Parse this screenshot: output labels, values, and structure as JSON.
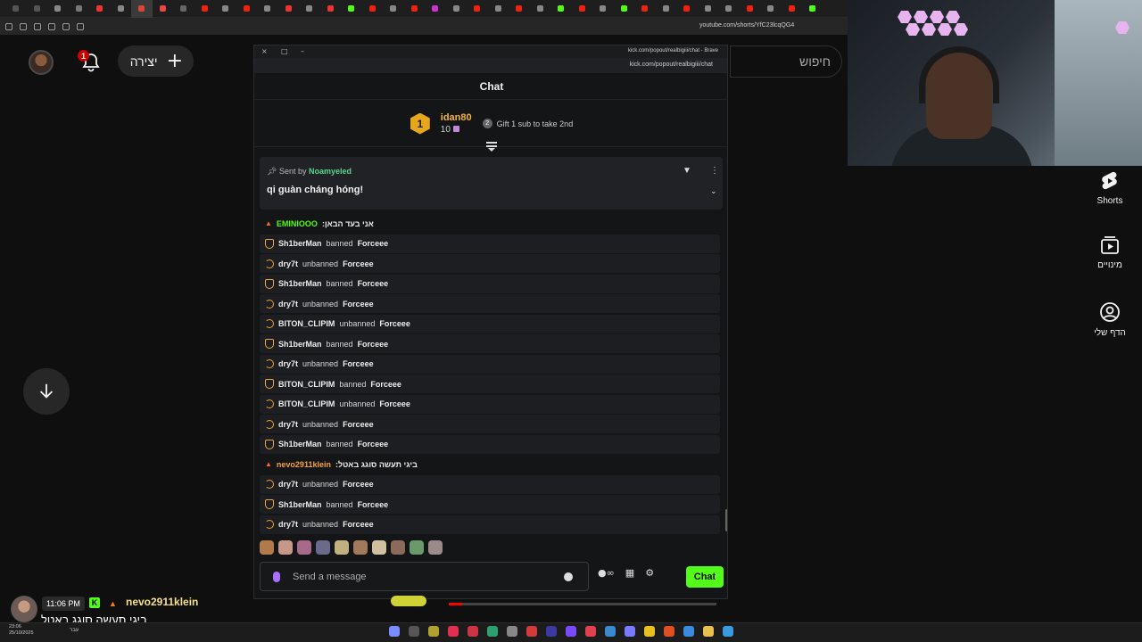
{
  "browser": {
    "url": "youtube.com/shorts/YfC23lcqQG4",
    "tab_colors": [
      "#555",
      "#555",
      "#888",
      "#777",
      "#e33",
      "#888",
      "#d43",
      "#e44",
      "#666",
      "#e21",
      "#888",
      "#e21",
      "#888",
      "#e33",
      "#888",
      "#e33",
      "#53fc18",
      "#e21",
      "#888",
      "#e21",
      "#c3c",
      "#888",
      "#e21",
      "#888",
      "#e21",
      "#888",
      "#53fc18",
      "#e21",
      "#888",
      "#53fc18",
      "#e21",
      "#888",
      "#e21",
      "#888",
      "#888",
      "#e21",
      "#888",
      "#e21",
      "#53fc18"
    ]
  },
  "youtube": {
    "notifications_count": "1",
    "create_label": "יצירה",
    "search_placeholder": "חיפוש",
    "rail": [
      {
        "label": "Shorts",
        "icon": "shorts-icon"
      },
      {
        "label": "מינויים",
        "icon": "subscriptions-icon"
      },
      {
        "label": "הדף שלי",
        "icon": "account-icon"
      }
    ]
  },
  "popup": {
    "window_title": "kick.com/popout/realbigiii/chat - Brave",
    "address": "kick.com/popout/realbigiii/chat",
    "chat_title": "Chat",
    "leaderboard": {
      "rank": "1",
      "username": "idan80",
      "count": "10",
      "rank2_badge": "2",
      "gift_text": "Gift 1 sub to take 2nd"
    },
    "pinned": {
      "sent_by_label": "Sent by",
      "sender": "Noamyeled",
      "message": "qi guàn cháng hóng!"
    },
    "messages": [
      {
        "type": "chat",
        "user": "EMINIOOO",
        "color": "green",
        "text": ":אני בעד הבאן"
      },
      {
        "type": "mod",
        "icon": "shield",
        "actor": "Sh1berMan",
        "action": "banned",
        "target": "Forceee"
      },
      {
        "type": "mod",
        "icon": "undo",
        "actor": "dry7t",
        "action": "unbanned",
        "target": "Forceee"
      },
      {
        "type": "mod",
        "icon": "shield",
        "actor": "Sh1berMan",
        "action": "banned",
        "target": "Forceee"
      },
      {
        "type": "mod",
        "icon": "undo",
        "actor": "dry7t",
        "action": "unbanned",
        "target": "Forceee"
      },
      {
        "type": "mod",
        "icon": "undo",
        "actor": "BITON_CLIPIM",
        "action": "unbanned",
        "target": "Forceee"
      },
      {
        "type": "mod",
        "icon": "shield",
        "actor": "Sh1berMan",
        "action": "banned",
        "target": "Forceee"
      },
      {
        "type": "mod",
        "icon": "undo",
        "actor": "dry7t",
        "action": "unbanned",
        "target": "Forceee"
      },
      {
        "type": "mod",
        "icon": "shield",
        "actor": "BITON_CLIPIM",
        "action": "banned",
        "target": "Forceee"
      },
      {
        "type": "mod",
        "icon": "undo",
        "actor": "BITON_CLIPIM",
        "action": "unbanned",
        "target": "Forceee"
      },
      {
        "type": "mod",
        "icon": "undo",
        "actor": "dry7t",
        "action": "unbanned",
        "target": "Forceee"
      },
      {
        "type": "mod",
        "icon": "shield",
        "actor": "Sh1berMan",
        "action": "banned",
        "target": "Forceee"
      },
      {
        "type": "chat",
        "user": "nevo2911klein",
        "color": "orange",
        "text": ":ביגי תעשה סוגג באטל"
      },
      {
        "type": "mod",
        "icon": "undo",
        "actor": "dry7t",
        "action": "unbanned",
        "target": "Forceee"
      },
      {
        "type": "mod",
        "icon": "shield",
        "actor": "Sh1berMan",
        "action": "banned",
        "target": "Forceee"
      },
      {
        "type": "mod",
        "icon": "undo",
        "actor": "dry7t",
        "action": "unbanned",
        "target": "Forceee"
      }
    ],
    "emote_colors": [
      "#b07a4a",
      "#c7988a",
      "#a86a8a",
      "#6a6a8a",
      "#c0b080",
      "#a07a5a",
      "#d0c0a0",
      "#8a6a5a",
      "#6a9a6a",
      "#9a8a8a"
    ],
    "input_placeholder": "Send a message",
    "send_label": "Chat",
    "infinity_label": "∞"
  },
  "overlay": {
    "time": "11:06 PM",
    "kick_label": "K",
    "username": "nevo2911klein",
    "message": "ביגי תעשה סוגג באטל"
  },
  "video": {
    "progress": 0.05
  },
  "taskbar": {
    "time": "23:06",
    "date": "25/10/2025",
    "lang": "עבר",
    "app_colors": [
      "#7a8aff",
      "#555",
      "#b0a030",
      "#e03050",
      "#cc3344",
      "#2f9f6f",
      "#888",
      "#d43a3a",
      "#3a3aa0",
      "#7a4aff",
      "#e04050",
      "#3a8ad0",
      "#7a7aff",
      "#e8c020",
      "#e05020",
      "#3a8ae0",
      "#e8c050",
      "#3a9ae0"
    ]
  },
  "colors": {
    "kick_green": "#53fc18",
    "mod_orange": "#f0a53c",
    "youtube_red": "#ff0000"
  }
}
